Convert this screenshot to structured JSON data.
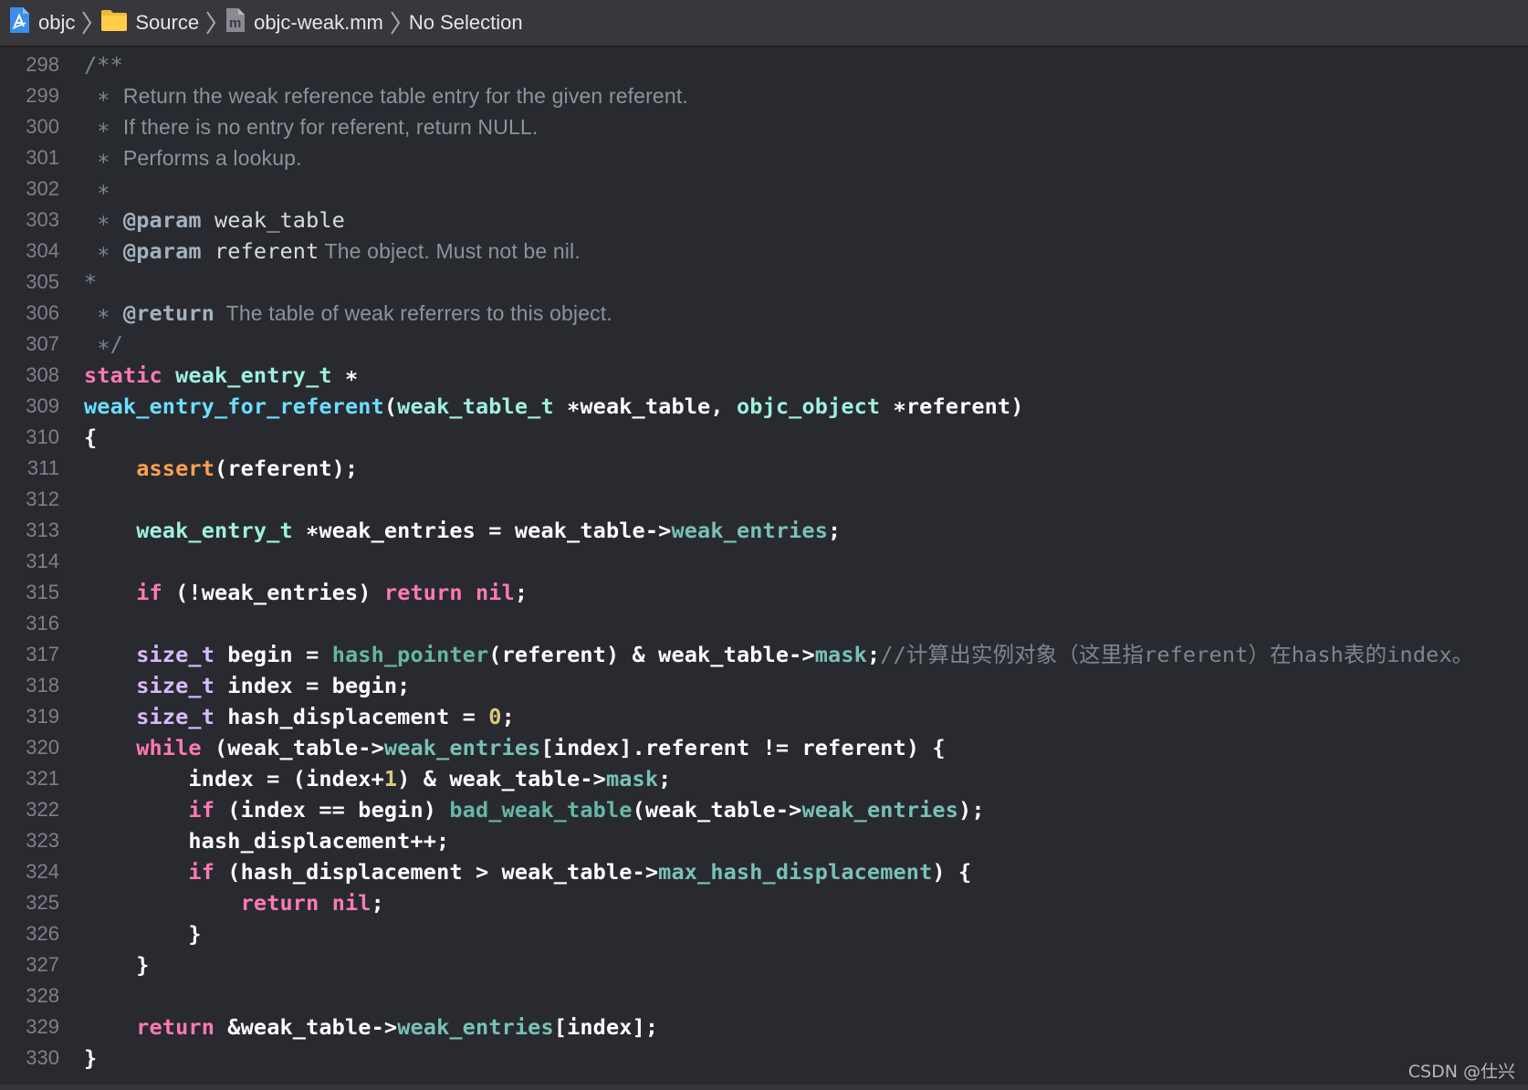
{
  "jump_bar": {
    "items": [
      {
        "label": "objc",
        "icon": "xcode-project-icon"
      },
      {
        "label": "Source",
        "icon": "folder-icon"
      },
      {
        "label": "objc-weak.mm",
        "icon": "objc-source-file-icon"
      },
      {
        "label": "No Selection",
        "icon": ""
      }
    ]
  },
  "editor": {
    "theme_colors": {
      "background": "#292a30",
      "keyword": "#ff7ab2",
      "type": "#dabaff",
      "function": "#6bdfff",
      "macro": "#ffa14f",
      "member": "#78c2b3",
      "comment": "#7d868f",
      "number": "#d9c97c"
    },
    "lines": [
      {
        "n": "298",
        "tokens": [
          [
            "comment",
            "/**"
          ]
        ]
      },
      {
        "n": "299",
        "tokens": [
          [
            "comment",
            " ∗ "
          ],
          [
            "prose",
            "Return the weak reference table entry for the given referent."
          ]
        ]
      },
      {
        "n": "300",
        "tokens": [
          [
            "comment",
            " ∗ "
          ],
          [
            "prose",
            "If there is no entry for referent, return NULL."
          ]
        ]
      },
      {
        "n": "301",
        "tokens": [
          [
            "comment",
            " ∗ "
          ],
          [
            "prose",
            "Performs a lookup."
          ]
        ]
      },
      {
        "n": "302",
        "tokens": [
          [
            "comment",
            " ∗"
          ]
        ]
      },
      {
        "n": "303",
        "tokens": [
          [
            "comment",
            " ∗ "
          ],
          [
            "doc",
            "@param"
          ],
          [
            "docword",
            " weak_table"
          ]
        ]
      },
      {
        "n": "304",
        "tokens": [
          [
            "comment",
            " ∗ "
          ],
          [
            "doc",
            "@param"
          ],
          [
            "docword",
            " referent"
          ],
          [
            "prose",
            " The object. Must not be nil."
          ]
        ]
      },
      {
        "n": "305",
        "tokens": [
          [
            "comment",
            "*"
          ]
        ]
      },
      {
        "n": "306",
        "tokens": [
          [
            "comment",
            " ∗ "
          ],
          [
            "doc",
            "@return"
          ],
          [
            "prose",
            "  The table of weak referrers to this object."
          ]
        ]
      },
      {
        "n": "307",
        "tokens": [
          [
            "comment",
            " ∗/"
          ]
        ]
      },
      {
        "n": "308",
        "tokens": [
          [
            "keyword",
            "static"
          ],
          [
            "plain",
            " "
          ],
          [
            "usertype",
            "weak_entry_t"
          ],
          [
            "plain",
            " ∗"
          ]
        ]
      },
      {
        "n": "309",
        "tokens": [
          [
            "func",
            "weak_entry_for_referent"
          ],
          [
            "plain",
            "("
          ],
          [
            "usertype",
            "weak_table_t"
          ],
          [
            "plain",
            " ∗weak_table, "
          ],
          [
            "usertype",
            "objc_object"
          ],
          [
            "plain",
            " ∗referent)"
          ]
        ]
      },
      {
        "n": "310",
        "tokens": [
          [
            "plain",
            "{"
          ]
        ]
      },
      {
        "n": "311",
        "tokens": [
          [
            "plain",
            "    "
          ],
          [
            "macro",
            "assert"
          ],
          [
            "plain",
            "(referent);"
          ]
        ]
      },
      {
        "n": "312",
        "tokens": []
      },
      {
        "n": "313",
        "tokens": [
          [
            "plain",
            "    "
          ],
          [
            "usertype",
            "weak_entry_t"
          ],
          [
            "plain",
            " ∗weak_entries = weak_table->"
          ],
          [
            "member",
            "weak_entries"
          ],
          [
            "plain",
            ";"
          ]
        ]
      },
      {
        "n": "314",
        "tokens": []
      },
      {
        "n": "315",
        "tokens": [
          [
            "plain",
            "    "
          ],
          [
            "keyword",
            "if"
          ],
          [
            "plain",
            " (!weak_entries) "
          ],
          [
            "keyword",
            "return"
          ],
          [
            "plain",
            " "
          ],
          [
            "keyword",
            "nil"
          ],
          [
            "plain",
            ";"
          ]
        ]
      },
      {
        "n": "316",
        "tokens": []
      },
      {
        "n": "317",
        "tokens": [
          [
            "plain",
            "    "
          ],
          [
            "type",
            "size_t"
          ],
          [
            "plain",
            " begin = "
          ],
          [
            "ufunc",
            "hash_pointer"
          ],
          [
            "plain",
            "(referent) & weak_table->"
          ],
          [
            "member",
            "mask"
          ],
          [
            "plain",
            ";"
          ],
          [
            "commentmono",
            "//"
          ],
          [
            "cjk",
            "计算出实例对象（这里指"
          ],
          [
            "commentmono",
            "referent"
          ],
          [
            "cjk",
            "）在"
          ],
          [
            "commentmono",
            "hash"
          ],
          [
            "cjk",
            "表的"
          ],
          [
            "commentmono",
            "index"
          ],
          [
            "cjk",
            "。"
          ]
        ]
      },
      {
        "n": "318",
        "tokens": [
          [
            "plain",
            "    "
          ],
          [
            "type",
            "size_t"
          ],
          [
            "plain",
            " index = begin;"
          ]
        ]
      },
      {
        "n": "319",
        "tokens": [
          [
            "plain",
            "    "
          ],
          [
            "type",
            "size_t"
          ],
          [
            "plain",
            " hash_displacement = "
          ],
          [
            "number",
            "0"
          ],
          [
            "plain",
            ";"
          ]
        ]
      },
      {
        "n": "320",
        "tokens": [
          [
            "plain",
            "    "
          ],
          [
            "keyword",
            "while"
          ],
          [
            "plain",
            " (weak_table->"
          ],
          [
            "member",
            "weak_entries"
          ],
          [
            "plain",
            "[index].referent != referent) {"
          ]
        ]
      },
      {
        "n": "321",
        "tokens": [
          [
            "plain",
            "        index = (index+"
          ],
          [
            "number",
            "1"
          ],
          [
            "plain",
            ") & weak_table->"
          ],
          [
            "member",
            "mask"
          ],
          [
            "plain",
            ";"
          ]
        ]
      },
      {
        "n": "322",
        "tokens": [
          [
            "plain",
            "        "
          ],
          [
            "keyword",
            "if"
          ],
          [
            "plain",
            " (index == begin) "
          ],
          [
            "ufunc",
            "bad_weak_table"
          ],
          [
            "plain",
            "(weak_table->"
          ],
          [
            "member",
            "weak_entries"
          ],
          [
            "plain",
            ");"
          ]
        ]
      },
      {
        "n": "323",
        "tokens": [
          [
            "plain",
            "        hash_displacement++;"
          ]
        ]
      },
      {
        "n": "324",
        "tokens": [
          [
            "plain",
            "        "
          ],
          [
            "keyword",
            "if"
          ],
          [
            "plain",
            " (hash_displacement > weak_table->"
          ],
          [
            "member",
            "max_hash_displacement"
          ],
          [
            "plain",
            ") {"
          ]
        ]
      },
      {
        "n": "325",
        "tokens": [
          [
            "plain",
            "            "
          ],
          [
            "keyword",
            "return"
          ],
          [
            "plain",
            " "
          ],
          [
            "keyword",
            "nil"
          ],
          [
            "plain",
            ";"
          ]
        ]
      },
      {
        "n": "326",
        "tokens": [
          [
            "plain",
            "        }"
          ]
        ]
      },
      {
        "n": "327",
        "tokens": [
          [
            "plain",
            "    }"
          ]
        ]
      },
      {
        "n": "328",
        "tokens": []
      },
      {
        "n": "329",
        "tokens": [
          [
            "plain",
            "    "
          ],
          [
            "keyword",
            "return"
          ],
          [
            "plain",
            " &weak_table->"
          ],
          [
            "member",
            "weak_entries"
          ],
          [
            "plain",
            "[index];"
          ]
        ]
      },
      {
        "n": "330",
        "tokens": [
          [
            "plain",
            "}"
          ]
        ]
      }
    ]
  },
  "watermark": "CSDN @仕兴"
}
